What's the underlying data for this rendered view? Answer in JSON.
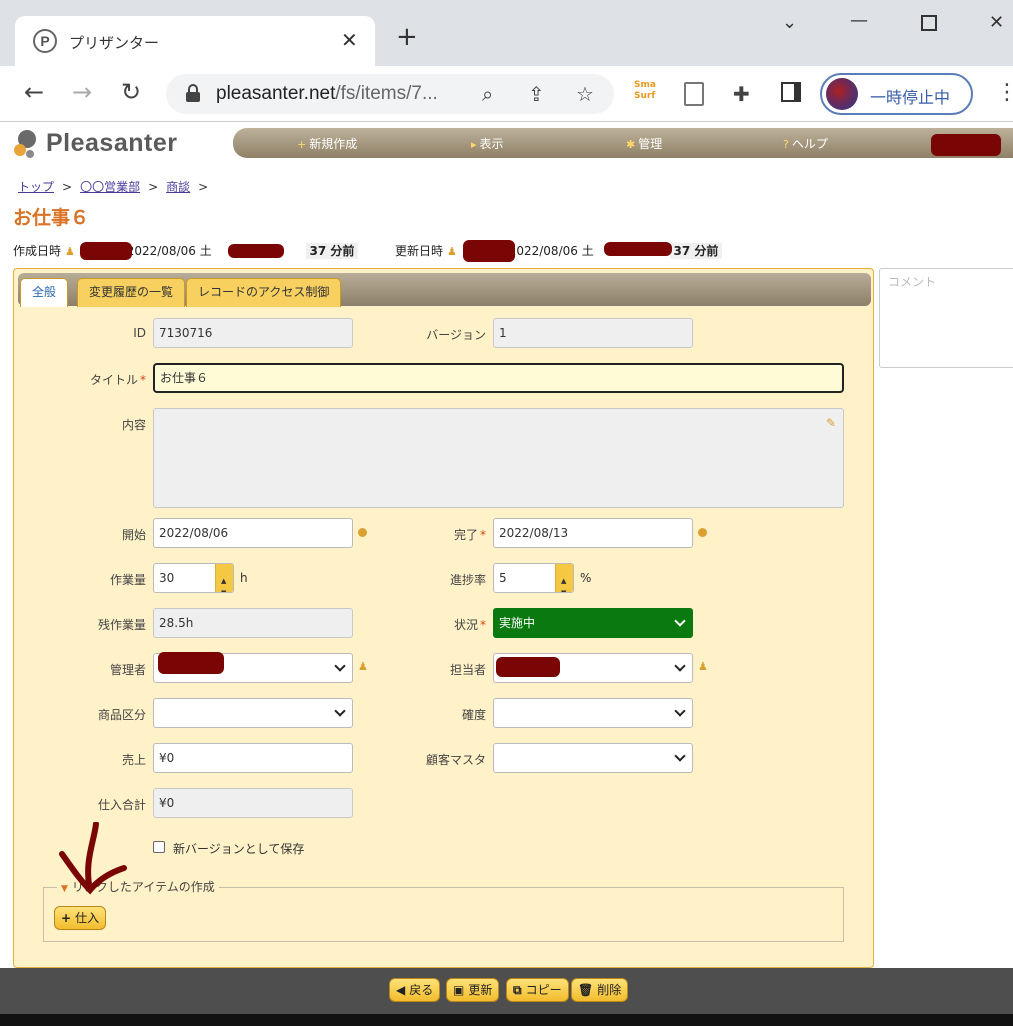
{
  "browser": {
    "tab_title": "プリザンター",
    "tab_favicon": "P",
    "url_host": "pleasanter.net",
    "url_path": "/fs/items/7...",
    "pause_label": "一時停止中",
    "ext_label_top": "Sma",
    "ext_label_bottom": "Surf"
  },
  "app": {
    "logo": "Pleasanter",
    "menu": [
      {
        "icon": "+",
        "label": "新規作成"
      },
      {
        "icon": "▸",
        "label": "表示"
      },
      {
        "icon": "✱",
        "label": "管理"
      },
      {
        "icon": "?",
        "label": "ヘルプ"
      }
    ]
  },
  "breadcrumb": [
    "トップ",
    "〇〇営業部",
    "商談"
  ],
  "breadcrumb_sep": ">",
  "title": "お仕事６",
  "meta": {
    "created_label": "作成日時",
    "created_date": "2022/08/06 土",
    "created_ago": "37 分前",
    "updated_label": "更新日時",
    "updated_date": "2022/08/06 土",
    "updated_ago": "37 分前"
  },
  "tabs": [
    "全般",
    "変更履歴の一覧",
    "レコードのアクセス制御"
  ],
  "fields": {
    "id_label": "ID",
    "id": "7130716",
    "version_label": "バージョン",
    "version": "1",
    "title_label": "タイトル",
    "title": "お仕事６",
    "body_label": "内容",
    "start_label": "開始",
    "start": "2022/08/06",
    "end_label": "完了",
    "end": "2022/08/13",
    "work_label": "作業量",
    "work": "30",
    "work_unit": "h",
    "progress_label": "進捗率",
    "progress": "5",
    "progress_unit": "%",
    "remaining_label": "残作業量",
    "remaining": "28.5h",
    "status_label": "状況",
    "status": "実施中",
    "manager_label": "管理者",
    "owner_label": "担当者",
    "category_label": "商品区分",
    "certainty_label": "確度",
    "sales_label": "売上",
    "sales": "¥0",
    "customer_label": "顧客マスタ",
    "purchase_label": "仕入合計",
    "purchase": "¥0",
    "new_version_label": "新バージョンとして保存"
  },
  "links_section": {
    "legend": "リンクしたアイテムの作成",
    "button_label": "仕入"
  },
  "comment_placeholder": "コメント",
  "footer": {
    "back": "戻る",
    "update": "更新",
    "copy": "コピー",
    "delete": "削除"
  },
  "colors": {
    "accent": "#d97326",
    "status_bg": "#0a7a10",
    "panel_bg": "#fff1c8",
    "button_yellow": "#f2bc2c"
  }
}
